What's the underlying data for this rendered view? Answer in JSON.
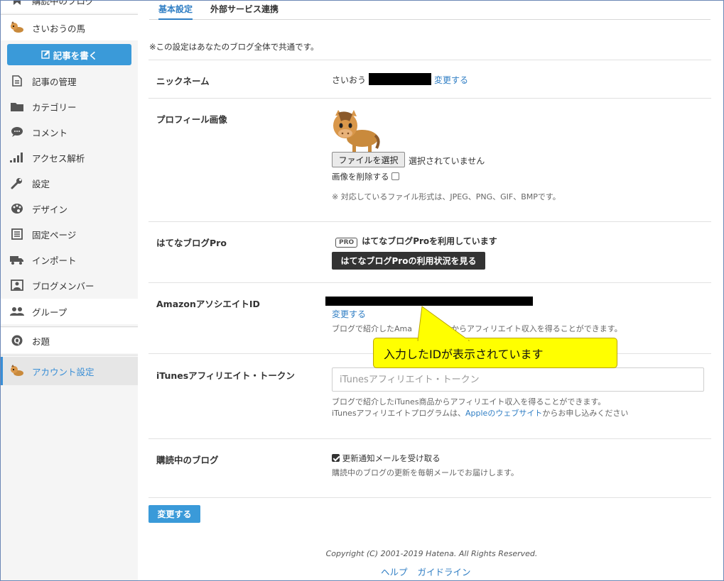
{
  "sidebar": {
    "top_partial_label": "購読中のブログ",
    "blog_name": "さいおうの馬",
    "write_button": "記事を書く",
    "items": [
      {
        "label": "記事の管理",
        "icon": "document-icon"
      },
      {
        "label": "カテゴリー",
        "icon": "folder-icon"
      },
      {
        "label": "コメント",
        "icon": "comment-icon"
      },
      {
        "label": "アクセス解析",
        "icon": "signal-icon"
      },
      {
        "label": "設定",
        "icon": "wrench-icon"
      },
      {
        "label": "デザイン",
        "icon": "palette-icon"
      },
      {
        "label": "固定ページ",
        "icon": "page-icon"
      },
      {
        "label": "インポート",
        "icon": "truck-icon"
      },
      {
        "label": "ブログメンバー",
        "icon": "member-icon"
      }
    ],
    "group": "グループ",
    "odai": "お題",
    "account": "アカウント設定"
  },
  "tabs": [
    {
      "label": "基本設定",
      "active": true
    },
    {
      "label": "外部サービス連携",
      "active": false
    }
  ],
  "note": "※この設定はあなたのブログ全体で共通です。",
  "nickname": {
    "label": "ニックネーム",
    "value": "さいおう",
    "change": "変更する"
  },
  "profile_image": {
    "label": "プロフィール画像",
    "file_button": "ファイルを選択",
    "no_file": "選択されていません",
    "delete_label": "画像を削除する",
    "delete_checked": false,
    "formats": "※ 対応しているファイル形式は、JPEG、PNG、GIF、BMPです。"
  },
  "pro": {
    "label": "はてなブログPro",
    "badge": "PRO",
    "status": "はてなブログProを利用しています",
    "button": "はてなブログProの利用状況を見る"
  },
  "amazon": {
    "label": "AmazonアソシエイトID",
    "change": "変更する",
    "help": "ブログで紹介したAma　　　　　からアフィリエイト収入を得ることができます。"
  },
  "callout": {
    "text": "入力したIDが表示されています"
  },
  "itunes": {
    "label": "iTunesアフィリエイト・トークン",
    "placeholder": "iTunesアフィリエイト・トークン",
    "help1": "ブログで紹介したiTunes商品からアフィリエイト収入を得ることができます。",
    "help2_prefix": "iTunesアフィリエイトプログラムは、",
    "help2_link": "Appleのウェブサイト",
    "help2_suffix": "からお申し込みください"
  },
  "subscribe": {
    "label": "購読中のブログ",
    "checkbox_label": "更新通知メールを受け取る",
    "checked": true,
    "help": "購読中のブログの更新を毎朝メールでお届けします。"
  },
  "submit": "変更する",
  "footer": {
    "copyright": "Copyright (C) 2001-2019 Hatena. All Rights Reserved.",
    "help": "ヘルプ",
    "guideline": "ガイドライン"
  },
  "colors": {
    "accent": "#3a9ad9",
    "link": "#2f7ec4",
    "callout": "#ffff00"
  }
}
